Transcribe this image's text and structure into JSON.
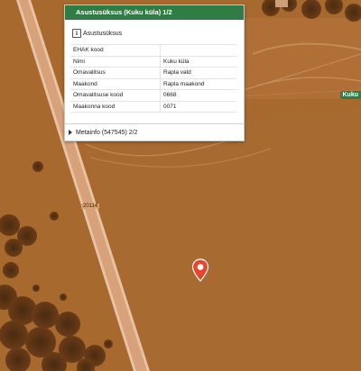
{
  "popup": {
    "title": "Asustusüksus (Kuku küla) 1/2",
    "subheader": "Asustusüksus",
    "info_icon_glyph": "i",
    "rows": [
      {
        "key": "EHAK kood",
        "value": ""
      },
      {
        "key": "Nimi",
        "value": "Kuku küla"
      },
      {
        "key": "Omavalitsus",
        "value": "Rapla vald"
      },
      {
        "key": "Maakond",
        "value": "Rapla maakond"
      },
      {
        "key": "Omavalitsuse kood",
        "value": "0668"
      },
      {
        "key": "Maakonna kood",
        "value": "0071"
      }
    ],
    "metainfo": "Metainfo (547545) 2/2"
  },
  "map": {
    "place_label": "Kuku",
    "road_number": "20114",
    "marker_icon": "map-pin-icon",
    "colors": {
      "field": "#a8692f",
      "road": "#d7a27a",
      "road_edge": "#e8c3a4",
      "trees": "#5c3416",
      "marker": "#e8452e",
      "header": "#2f7d45"
    }
  }
}
